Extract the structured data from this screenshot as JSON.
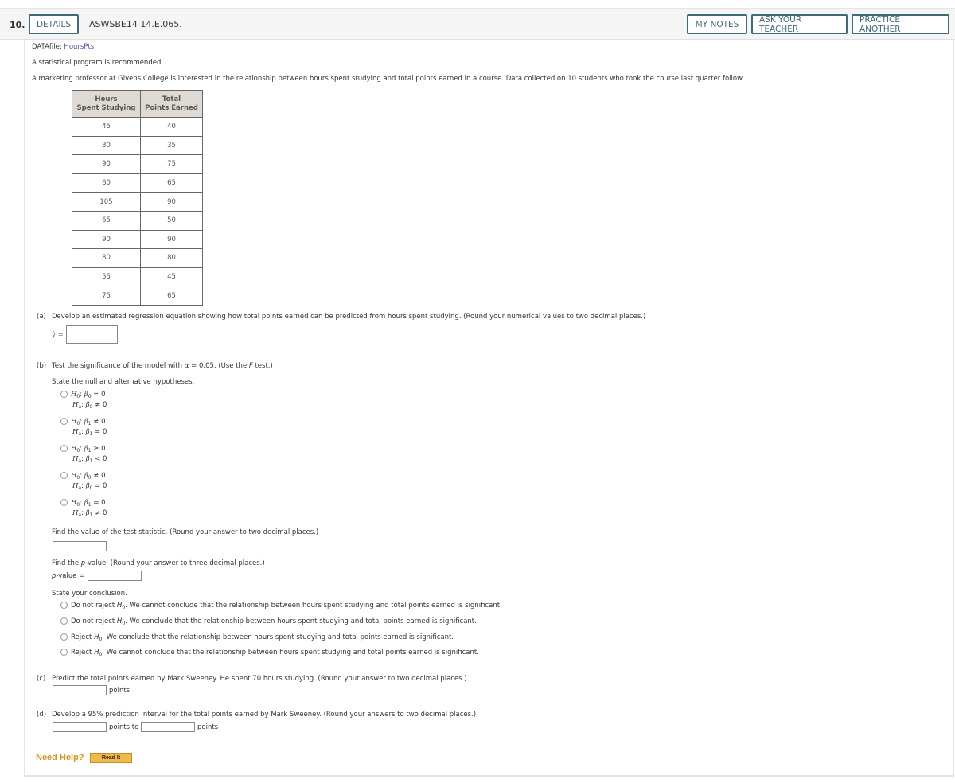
{
  "header": {
    "question_number": "10.",
    "details_label": "DETAILS",
    "question_code": "ASWSBE14 14.E.065.",
    "my_notes_label": "MY NOTES",
    "ask_teacher_label": "ASK YOUR TEACHER",
    "practice_another_label": "PRACTICE ANOTHER"
  },
  "intro": {
    "datafile_label": "DATAfile:",
    "datafile_link": "HoursPts",
    "recommendation": "A statistical program is recommended.",
    "problem": "A marketing professor at Givens College is interested in the relationship between hours spent studying and total points earned in a course. Data collected on 10 students who took the course last quarter follow."
  },
  "table": {
    "headers": [
      [
        "Hours",
        "Spent Studying"
      ],
      [
        "Total",
        "Points Earned"
      ]
    ],
    "rows": [
      [
        "45",
        "40"
      ],
      [
        "30",
        "35"
      ],
      [
        "90",
        "75"
      ],
      [
        "60",
        "65"
      ],
      [
        "105",
        "90"
      ],
      [
        "65",
        "50"
      ],
      [
        "90",
        "90"
      ],
      [
        "80",
        "80"
      ],
      [
        "55",
        "45"
      ],
      [
        "75",
        "65"
      ]
    ]
  },
  "part_a": {
    "label": "(a)",
    "prompt": "Develop an estimated regression equation showing how total points earned can be predicted from hours spent studying. (Round your numerical values to two decimal places.)",
    "yhat_label": "ŷ =",
    "value": ""
  },
  "part_b": {
    "label": "(b)",
    "prompt_pre": "Test the significance of the model with ",
    "alpha": "α",
    "prompt_mid": " = 0.05. (Use the ",
    "f": "F",
    "prompt_post": " test.)",
    "hyp_prompt": "State the null and alternative hypotheses.",
    "hypotheses": [
      {
        "h0": "β₀ = 0",
        "ha": "β₀ ≠ 0",
        "h0_param": "β",
        "h0_sub": "0",
        "h0_rel": "= 0",
        "ha_param": "β",
        "ha_sub": "0",
        "ha_rel": "≠ 0"
      },
      {
        "h0_param": "β",
        "h0_sub": "1",
        "h0_rel": "≠ 0",
        "ha_param": "β",
        "ha_sub": "1",
        "ha_rel": "= 0"
      },
      {
        "h0_param": "β",
        "h0_sub": "1",
        "h0_rel": "≥ 0",
        "ha_param": "β",
        "ha_sub": "1",
        "ha_rel": "< 0"
      },
      {
        "h0_param": "β",
        "h0_sub": "0",
        "h0_rel": "≠ 0",
        "ha_param": "β",
        "ha_sub": "0",
        "ha_rel": "= 0"
      },
      {
        "h0_param": "β",
        "h0_sub": "1",
        "h0_rel": "= 0",
        "ha_param": "β",
        "ha_sub": "1",
        "ha_rel": "≠ 0"
      }
    ],
    "h0_label": "H",
    "h0_sub": "0",
    "ha_label": "H",
    "ha_sub": "a",
    "test_stat_prompt": "Find the value of the test statistic. (Round your answer to two decimal places.)",
    "test_stat_value": "",
    "pvalue_prompt_pre": "Find the ",
    "pvalue_p": "p",
    "pvalue_prompt_post": "-value. (Round your answer to three decimal places.)",
    "pvalue_label_p": "p",
    "pvalue_label_rest": "-value =",
    "pvalue_value": "",
    "conclusion_prompt": "State your conclusion.",
    "conclusions": [
      {
        "pre": "Do not reject ",
        "post": ". We cannot conclude that the relationship between hours spent studying and total points earned is significant."
      },
      {
        "pre": "Do not reject ",
        "post": ". We conclude that the relationship between hours spent studying and total points earned is significant."
      },
      {
        "pre": "Reject ",
        "post": ". We conclude that the relationship between hours spent studying and total points earned is significant."
      },
      {
        "pre": "Reject ",
        "post": ". We cannot conclude that the relationship between hours spent studying and total points earned is significant."
      }
    ]
  },
  "part_c": {
    "label": "(c)",
    "prompt": "Predict the total points earned by Mark Sweeney. He spent 70 hours studying. (Round your answer to two decimal places.)",
    "unit": "points",
    "value": ""
  },
  "part_d": {
    "label": "(d)",
    "prompt": "Develop a 95% prediction interval for the total points earned by Mark Sweeney. (Round your answers to two decimal places.)",
    "mid": "points to",
    "unit": "points",
    "lower": "",
    "upper": ""
  },
  "help": {
    "label": "Need Help?",
    "read_it": "Read It"
  }
}
